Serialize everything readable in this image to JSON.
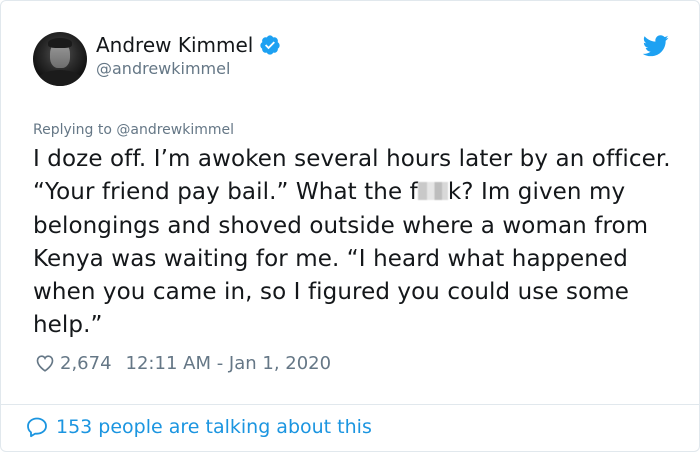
{
  "author": {
    "name": "Andrew Kimmel",
    "handle": "@andrewkimmel"
  },
  "reply": {
    "prefix": "Replying to",
    "mention": "@andrewkimmel"
  },
  "tweet": {
    "text_before": "I doze off. I’m awoken several hours later by an officer. “Your friend pay bail.” What the f",
    "text_after": "k? Im given my belongings and shoved outside where a woman from Kenya was waiting for me. “I heard what happened when you came in, so I figured you could use some help.”"
  },
  "meta": {
    "likes": "2,674",
    "timestamp": "12:11 AM - Jan 1, 2020"
  },
  "footer": {
    "talking": "153 people are talking about this"
  },
  "icons": {
    "verified": "verified-badge-icon",
    "twitter": "twitter-bird-icon",
    "like": "heart-icon",
    "conversation": "speech-bubble-icon"
  },
  "colors": {
    "accent": "#1da1f2",
    "link": "#1b95e0",
    "secondary_text": "#657786",
    "primary_text": "#14171a"
  }
}
